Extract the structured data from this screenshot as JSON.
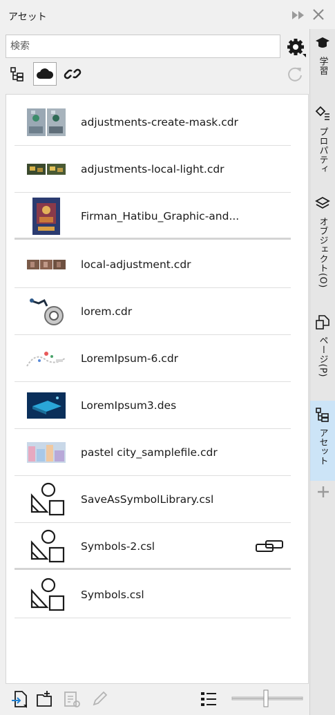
{
  "window": {
    "title": "アセット"
  },
  "search": {
    "placeholder": "検索"
  },
  "files": [
    {
      "name": "adjustments-create-mask.cdr"
    },
    {
      "name": "adjustments-local-light.cdr"
    },
    {
      "name": "Firman_Hatibu_Graphic-and..."
    },
    {
      "name": "local-adjustment.cdr"
    },
    {
      "name": "lorem.cdr"
    },
    {
      "name": "LoremIpsum-6.cdr"
    },
    {
      "name": "LoremIpsum3.des"
    },
    {
      "name": "pastel city_samplefile.cdr"
    },
    {
      "name": "SaveAsSymbolLibrary.csl"
    },
    {
      "name": "Symbols-2.csl"
    },
    {
      "name": "Symbols.csl"
    }
  ],
  "tabs": [
    {
      "label": "学習"
    },
    {
      "label": "プロパティ"
    },
    {
      "label": "オブジェクト(O)"
    },
    {
      "label": "ページ(P)"
    },
    {
      "label": "アセット"
    }
  ],
  "colors": {
    "active_tab": "#cce4f7",
    "accent": "#1e7fd1"
  }
}
